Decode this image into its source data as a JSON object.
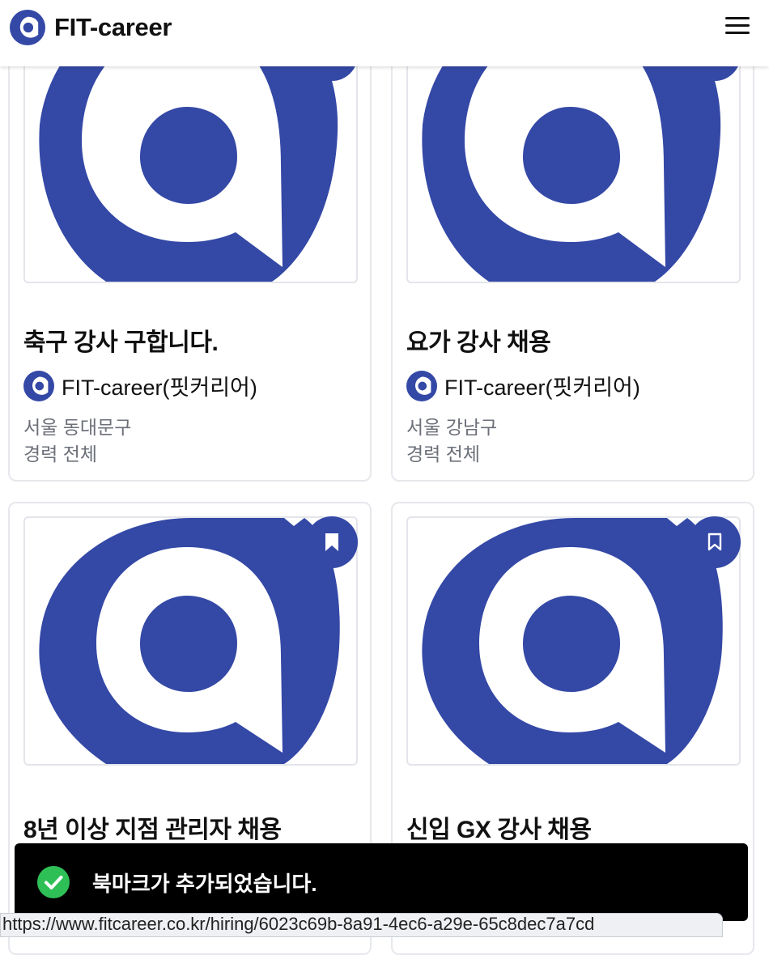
{
  "app": {
    "brand_name": "FIT-career",
    "menu_icon": "hamburger-menu-icon",
    "brand_color": "#3448a6"
  },
  "cards": [
    {
      "title": "축구 강사 구합니다.",
      "company": "FIT-career(핏커리어)",
      "location": "서울 동대문구",
      "experience": "경력 전체"
    },
    {
      "title": "요가 강사 채용",
      "company": "FIT-career(핏커리어)",
      "location": "서울 강남구",
      "experience": "경력 전체"
    },
    {
      "title": "8년 이상 지점 관리자 채용",
      "bookmarked": true
    },
    {
      "title": "신입 GX 강사 채용",
      "bookmarked": false
    }
  ],
  "toast": {
    "message": "북마크가 추가되었습니다.",
    "icon": "check-circle-icon",
    "color": "#2fbf57"
  },
  "statusbar": {
    "url": "https://www.fitcareer.co.kr/hiring/6023c69b-8a91-4ec6-a29e-65c8dec7a7cd"
  }
}
